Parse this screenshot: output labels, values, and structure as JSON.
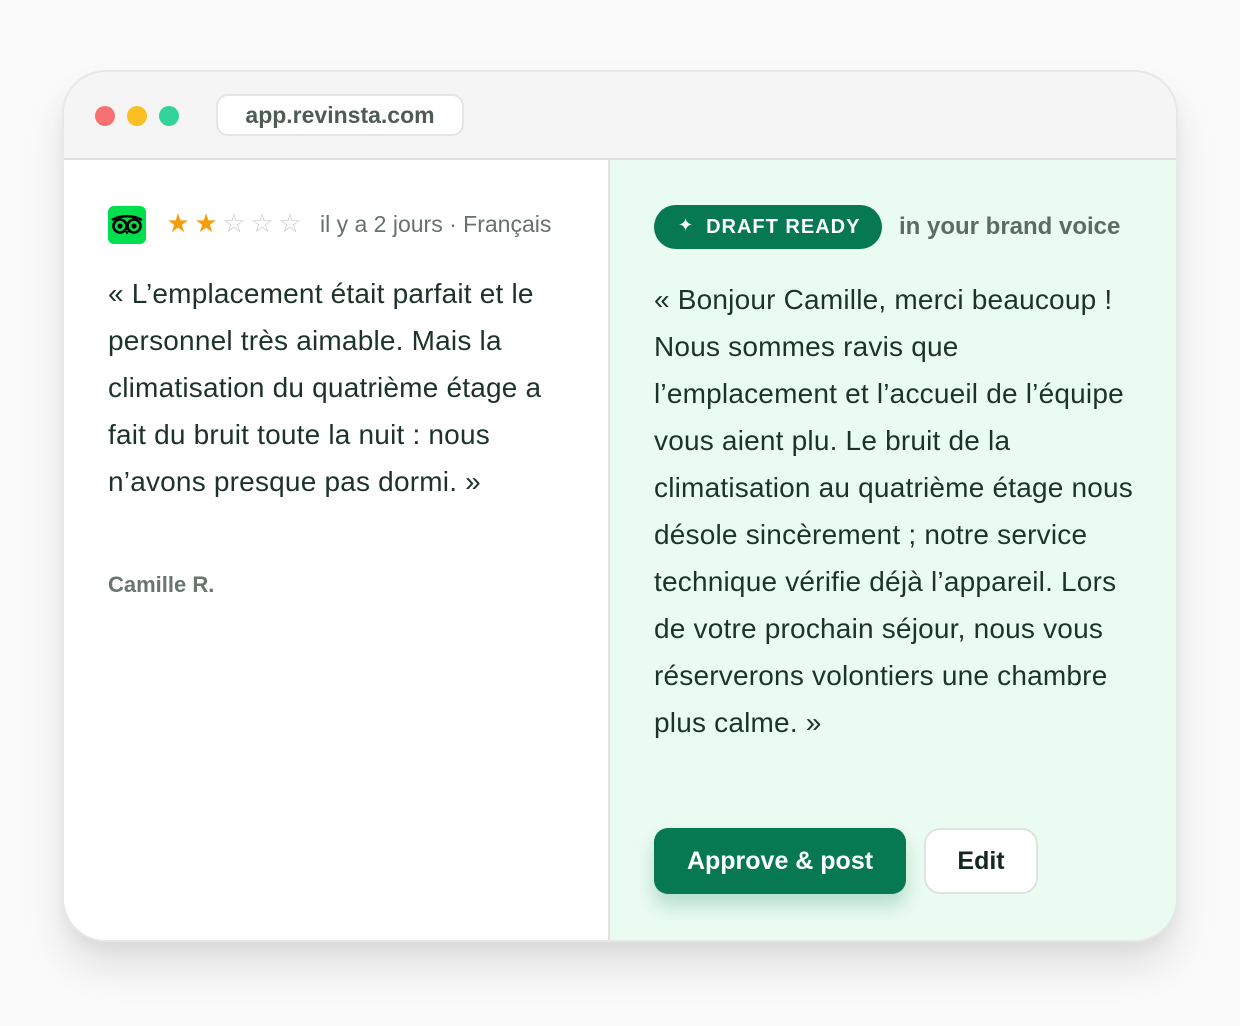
{
  "browser": {
    "url": "app.revinsta.com",
    "dots": [
      {
        "color": "#f87171",
        "icon": "close-dot"
      },
      {
        "color": "#fbbf24",
        "icon": "minimize-dot"
      },
      {
        "color": "#34d399",
        "icon": "maximize-dot"
      }
    ]
  },
  "review": {
    "platform_icon": "tripadvisor-owl-icon",
    "platform_color": "#00e04f",
    "rating": 2,
    "max_rating": 5,
    "star_filled_color": "#f59e0b",
    "star_empty_color": "#c9cdcb",
    "meta": "il y a 2 jours · Français",
    "text": "« L’emplacement était parfait et le personnel très aimable. Mais la climatisation du quatrième étage a fait du bruit toute la nuit : nous n’avons presque pas dormi. »",
    "author": "Camille R."
  },
  "draft": {
    "badge_icon": "sparkle-icon",
    "badge_label": "DRAFT READY",
    "subtitle": "in your brand voice",
    "text": "« Bonjour Camille, merci beaucoup ! Nous sommes ravis que l’emplacement et l’accueil de l’équipe vous aient plu. Le bruit de la climatisation au quatrième étage nous désole sincèrement ; notre service technique vérifie déjà l’appareil. Lors de votre prochain séjour, nous vous réserverons volontiers une chambre plus calme. »",
    "approve_label": "Approve & post",
    "edit_label": "Edit",
    "accent_color": "#067852"
  }
}
